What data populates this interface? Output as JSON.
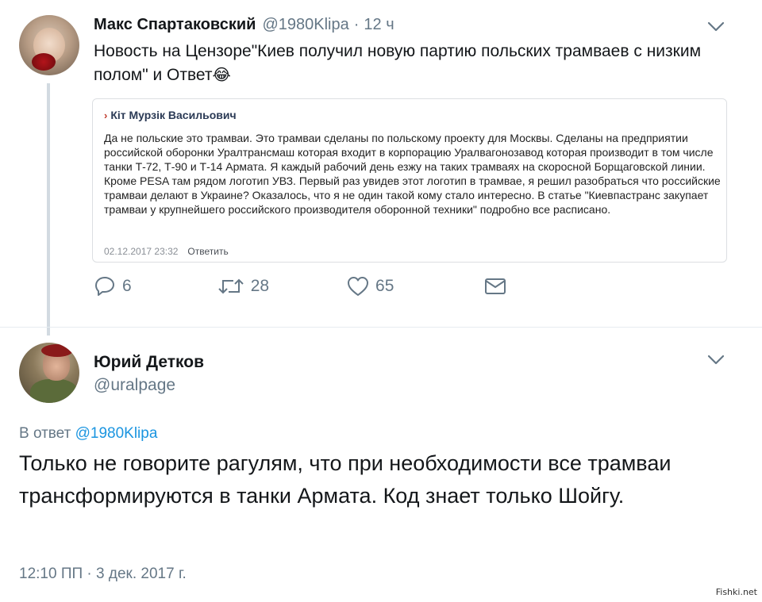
{
  "tweet1": {
    "display_name": "Макс Спартаковский",
    "handle": "@1980Klipa",
    "separator": "·",
    "time": "12 ч",
    "text": "Новость на Цензоре\"Киев получил новую партию польских трамваев с низким полом\" и Ответ",
    "emoji": "😂",
    "quote": {
      "author": "Кіт Мурзік Васильович",
      "arrow": "›",
      "body": "Да не польские это трамваи. Это трамваи сделаны по польскому проекту для Москвы. Сделаны на предприятии российской оборонки Уралтрансмаш которая входит в корпорацию Уралвагонозавод которая производит в том числе танки Т-72, Т-90 и Т-14 Армата. Я каждый рабочий день езжу на таких трамваях на скоросной Борщаговской линии. Кроме PESA там рядом логотип УВЗ. Первый раз увидев этот логотип в трамвае, я решил разобраться что российские трамваи делают в Украине? Оказалось, что я не один такой кому стало интересно. В статье \"Киевпастранс закупает трамваи у крупнейшего российского производителя оборонной техники\" подробно все расписано.",
      "date": "02.12.2017 23:32",
      "reply_label": "Ответить"
    },
    "actions": {
      "replies": "6",
      "retweets": "28",
      "likes": "65"
    }
  },
  "tweet2": {
    "display_name": "Юрий Детков",
    "handle": "@uralpage",
    "reply_prefix": "В ответ",
    "reply_mention": "@1980Klipa",
    "text": "Только не говорите рагулям, что при необходимости все трамваи трансформируются в танки Армата. Код знает только Шойгу.",
    "timestamp": "12:10 ПП · 3 дек. 2017 г."
  },
  "watermark": "Fishki.net",
  "colors": {
    "accent": "#1b95e0",
    "muted": "#657786",
    "text": "#14171a",
    "thread_line": "#d2dae1"
  },
  "icons": {
    "reply": "reply-icon",
    "retweet": "retweet-icon",
    "like": "heart-icon",
    "dm": "envelope-icon",
    "menu": "chevron-down-icon"
  }
}
